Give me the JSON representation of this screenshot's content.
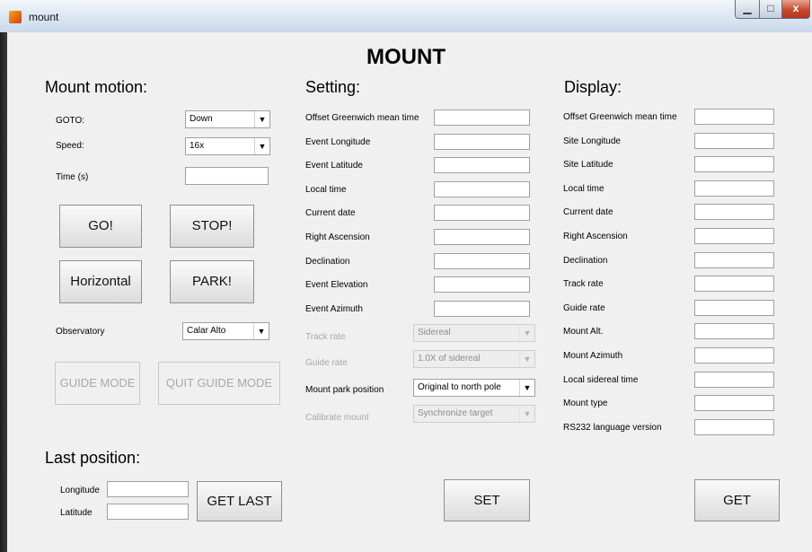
{
  "window": {
    "title": "mount",
    "min_label": "▁",
    "max_label": "□",
    "close_label": "x"
  },
  "main_title": "MOUNT",
  "motion": {
    "title": "Mount motion:",
    "goto_label": "GOTO:",
    "goto_value": "Down",
    "speed_label": "Speed:",
    "speed_value": "16x",
    "time_label": "Time (s)",
    "time_value": "",
    "go": "GO!",
    "stop": "STOP!",
    "horizontal": "Horizontal",
    "park": "PARK!",
    "observatory_label": "Observatory",
    "observatory_value": "Calar Alto",
    "guide_mode": "GUIDE MODE",
    "quit_guide_mode": "QUIT GUIDE MODE"
  },
  "last_position": {
    "title": "Last position:",
    "longitude_label": "Longitude",
    "longitude_value": "",
    "latitude_label": "Latitude",
    "latitude_value": "",
    "get_last": "GET LAST"
  },
  "setting": {
    "title": "Setting:",
    "fields": [
      {
        "label": "Offset Greenwich mean time",
        "value": ""
      },
      {
        "label": "Event Longitude",
        "value": ""
      },
      {
        "label": "Event Latitude",
        "value": ""
      },
      {
        "label": "Local time",
        "value": ""
      },
      {
        "label": "Current date",
        "value": ""
      },
      {
        "label": "Right Ascension",
        "value": ""
      },
      {
        "label": "Declination",
        "value": ""
      },
      {
        "label": "Event Elevation",
        "value": ""
      },
      {
        "label": "Event Azimuth",
        "value": ""
      }
    ],
    "track_rate_label": "Track rate",
    "track_rate_value": "Sidereal",
    "guide_rate_label": "Guide rate",
    "guide_rate_value": "1.0X of sidereal",
    "park_label": "Mount park position",
    "park_value": "Original to north pole",
    "calibrate_label": "Calibrate mount",
    "calibrate_value": "Synchronize target",
    "set": "SET"
  },
  "display": {
    "title": "Display:",
    "fields": [
      {
        "label": "Offset Greenwich mean time",
        "value": ""
      },
      {
        "label": "Site Longitude",
        "value": ""
      },
      {
        "label": "Site Latitude",
        "value": ""
      },
      {
        "label": "Local time",
        "value": ""
      },
      {
        "label": "Current date",
        "value": ""
      },
      {
        "label": "Right Ascension",
        "value": ""
      },
      {
        "label": "Declination",
        "value": ""
      },
      {
        "label": "Track rate",
        "value": ""
      },
      {
        "label": "Guide rate",
        "value": ""
      },
      {
        "label": "Mount Alt.",
        "value": ""
      },
      {
        "label": "Mount Azimuth",
        "value": ""
      },
      {
        "label": "Local sidereal time",
        "value": ""
      },
      {
        "label": "Mount type",
        "value": ""
      },
      {
        "label": "RS232 language version",
        "value": ""
      }
    ],
    "get": "GET"
  }
}
